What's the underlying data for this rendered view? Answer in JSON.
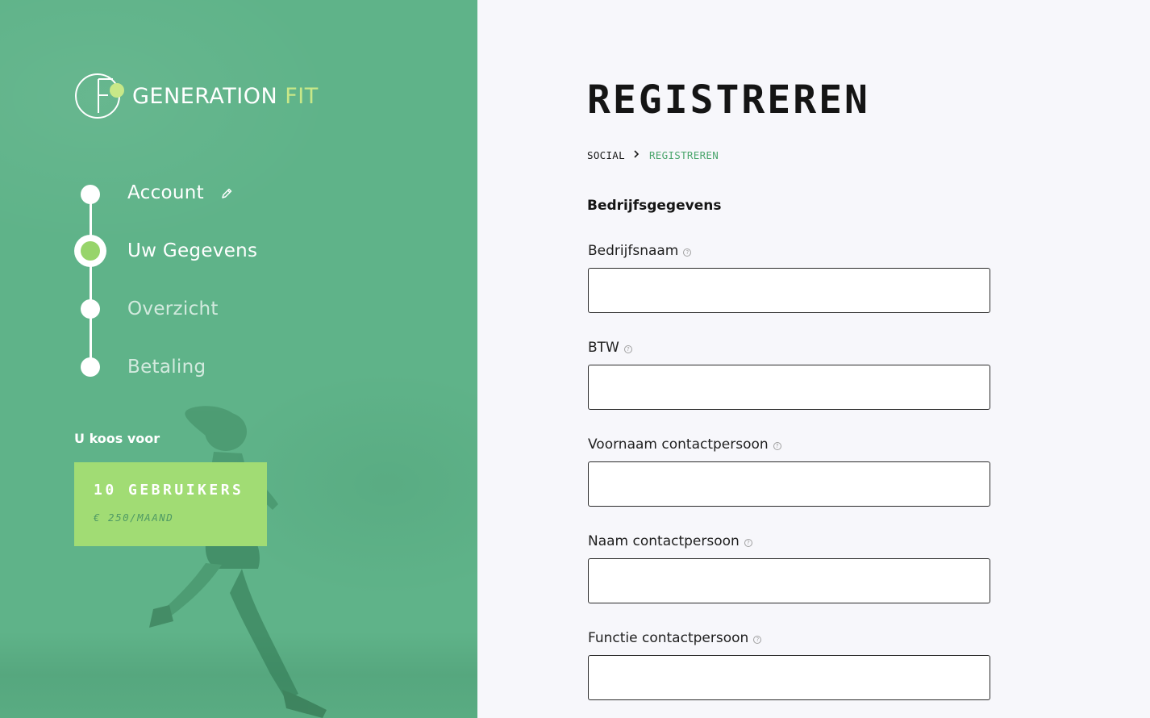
{
  "brand": {
    "name_part1": "GENERATION",
    "name_part2": "FIT",
    "accent_color": "#c8e888"
  },
  "steps": [
    {
      "label": "Account",
      "state": "done",
      "icon": "pencil-icon"
    },
    {
      "label": "Uw Gegevens",
      "state": "current"
    },
    {
      "label": "Overzicht",
      "state": "pending"
    },
    {
      "label": "Betaling",
      "state": "pending"
    }
  ],
  "selection": {
    "title": "U koos voor",
    "plan_name": "10 GEBRUIKERS",
    "plan_price": "€ 250/MAAND"
  },
  "page": {
    "title": "REGISTREREN",
    "breadcrumb": [
      "SOCIAL",
      "REGISTREREN"
    ],
    "section_title": "Bedrijfsgegevens"
  },
  "form": {
    "fields": [
      {
        "label": "Bedrijfsnaam",
        "value": "",
        "help_icon": "question-circle-icon"
      },
      {
        "label": "BTW",
        "value": "",
        "help_icon": "question-circle-icon"
      },
      {
        "label": "Voornaam contactpersoon",
        "value": "",
        "help_icon": "question-circle-icon"
      },
      {
        "label": "Naam contactpersoon",
        "value": "",
        "help_icon": "question-circle-icon"
      },
      {
        "label": "Functie contactpersoon",
        "value": "",
        "help_icon": "question-circle-icon"
      }
    ]
  },
  "colors": {
    "panel_green": "#5fb389",
    "card_green": "#a1dc74",
    "active_dot": "#97d46a",
    "breadcrumb_active": "#4aa56c",
    "background": "#f7f7fb"
  }
}
